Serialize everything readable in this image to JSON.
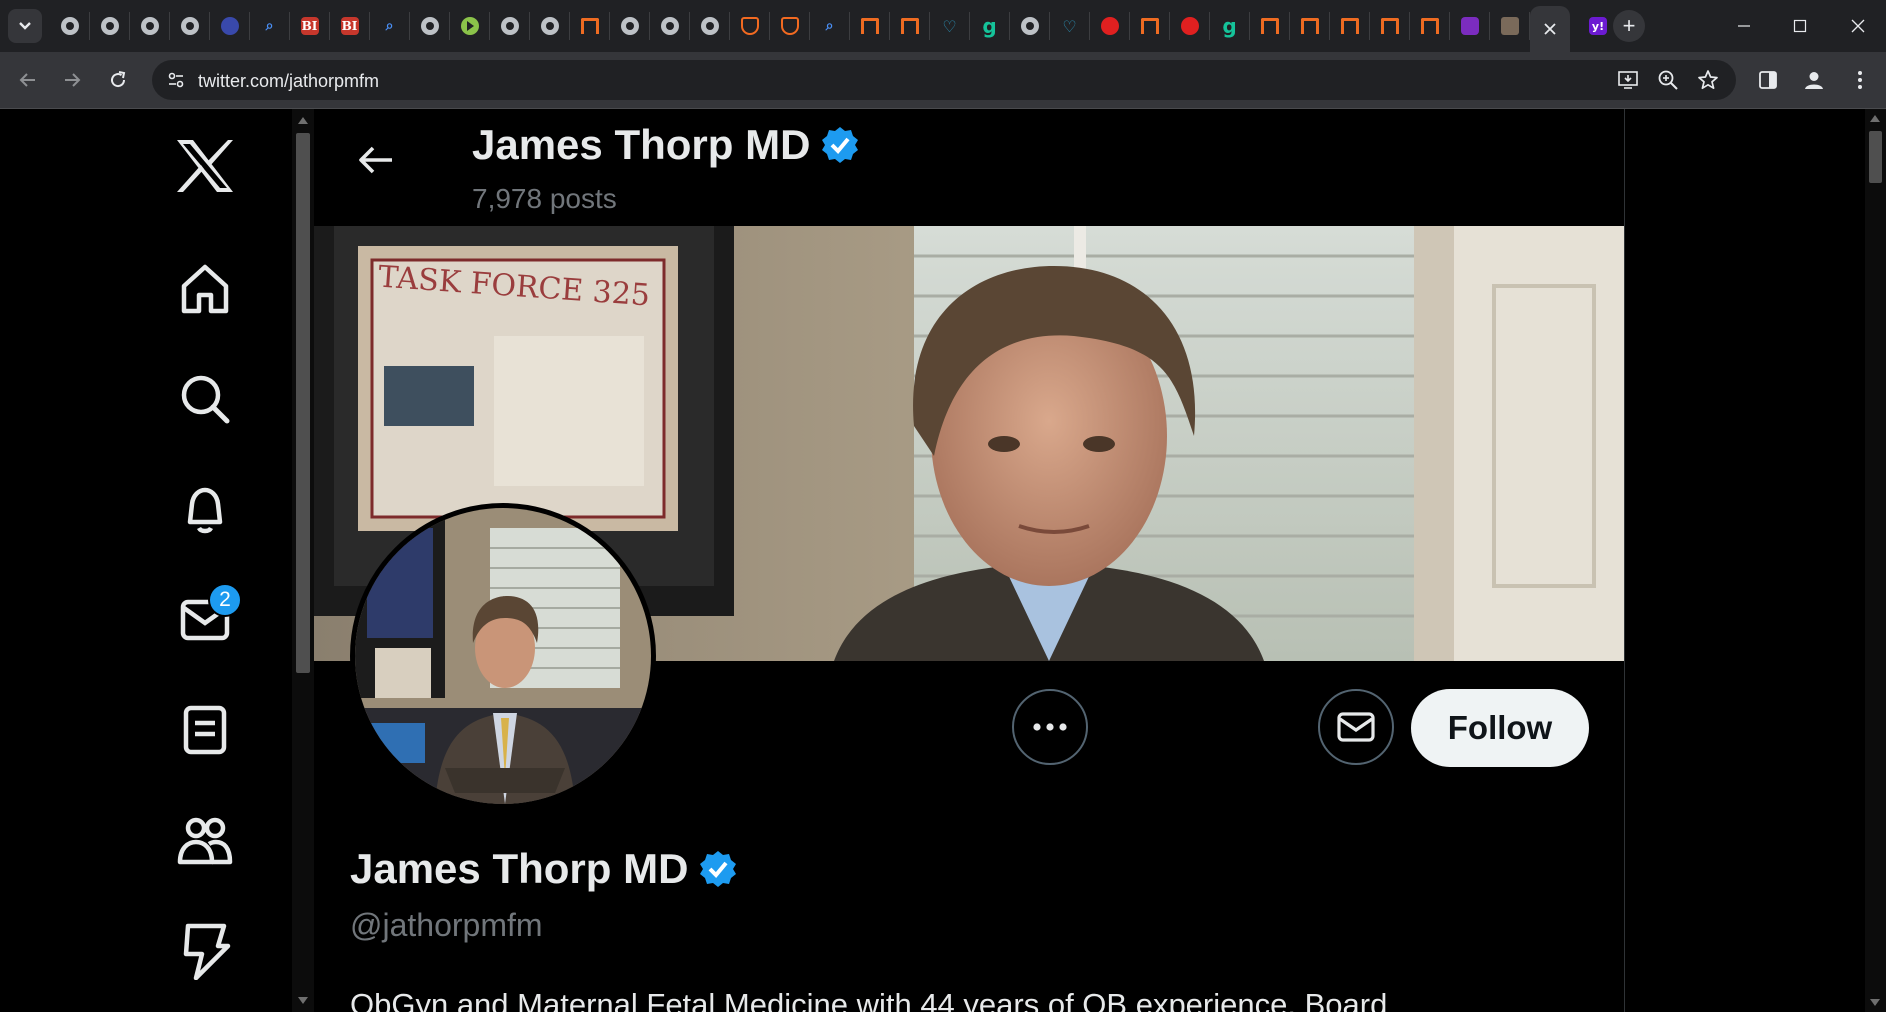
{
  "browser": {
    "url": "twitter.com/jathorpmfm",
    "favicons": [
      "globe",
      "globe",
      "globe",
      "globe",
      "dark",
      "search",
      "bi",
      "bi",
      "search",
      "globe",
      "play",
      "globe",
      "globe",
      "book",
      "globe",
      "globe",
      "globe",
      "shield",
      "shield",
      "search",
      "book",
      "book",
      "heart",
      "g",
      "globe",
      "heart",
      "down",
      "book",
      "down",
      "g",
      "book",
      "book",
      "book",
      "book",
      "book",
      "mail",
      "photo"
    ],
    "bi_label": "BI",
    "g_label": "g",
    "yahoo_label": "y!",
    "new_tab_label": "+"
  },
  "nav": {
    "messages_badge": "2"
  },
  "profile": {
    "header_name": "James Thorp MD",
    "posts_count": "7,978 posts",
    "name": "James Thorp MD",
    "handle": "@jathorpmfm",
    "bio": "ObGyn and Maternal Fetal Medicine with 44 years of OB experience. Board",
    "follow_label": "Follow",
    "banner_sign": "TASK FORCE 325"
  },
  "colors": {
    "accent": "#1d9bf0",
    "follow_bg": "#eff3f4",
    "muted": "#71767b"
  }
}
